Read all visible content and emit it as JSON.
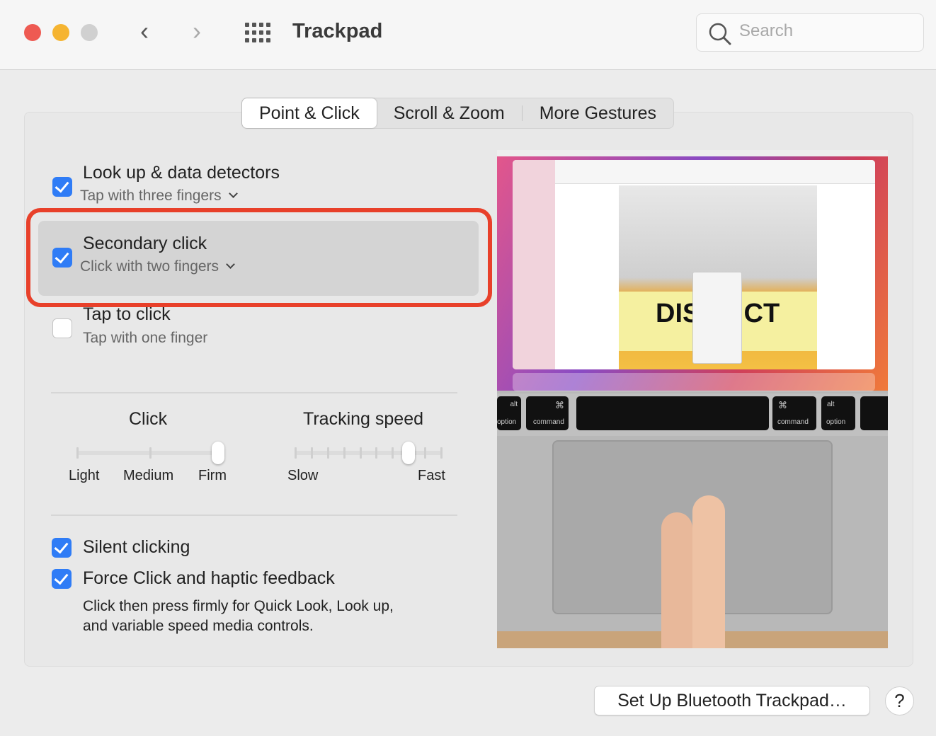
{
  "window": {
    "title": "Trackpad",
    "search_placeholder": "Search"
  },
  "tabs": [
    {
      "label": "Point & Click",
      "active": true
    },
    {
      "label": "Scroll & Zoom"
    },
    {
      "label": "More Gestures"
    }
  ],
  "options": [
    {
      "label": "Look up & data detectors",
      "sub": "Tap with three fingers",
      "checked": true
    },
    {
      "label": "Secondary click",
      "sub": "Click with two fingers",
      "checked": true,
      "highlighted": true
    },
    {
      "label": "Tap to click",
      "sub": "Tap with one finger",
      "checked": false
    }
  ],
  "click_slider": {
    "title": "Click",
    "labels": [
      "Light",
      "Medium",
      "Firm"
    ],
    "value": "Firm"
  },
  "tracking_slider": {
    "title": "Tracking speed",
    "min_label": "Slow",
    "max_label": "Fast",
    "value_step": 7,
    "steps": 10
  },
  "bottom_options": [
    {
      "label": "Silent clicking",
      "checked": true
    },
    {
      "label": "Force Click and haptic feedback",
      "checked": true,
      "desc_line1": "Click then press firmly for Quick Look, Look up,",
      "desc_line2": "and variable speed media controls."
    }
  ],
  "preview": {
    "keys": {
      "alt": "alt",
      "option": "option",
      "command": "command",
      "cmd_symbol": "⌘",
      "district": "DISTRICT",
      "hl_color": "#e8402a"
    }
  },
  "footer": {
    "setup_button": "Set Up Bluetooth Trackpad…",
    "help": "?"
  },
  "colors": {
    "accent": "#2f7cf6",
    "highlight": "#e8402a",
    "close": "#ee5a52",
    "minimize": "#f5b431",
    "zoom": "#d0d0d0"
  }
}
